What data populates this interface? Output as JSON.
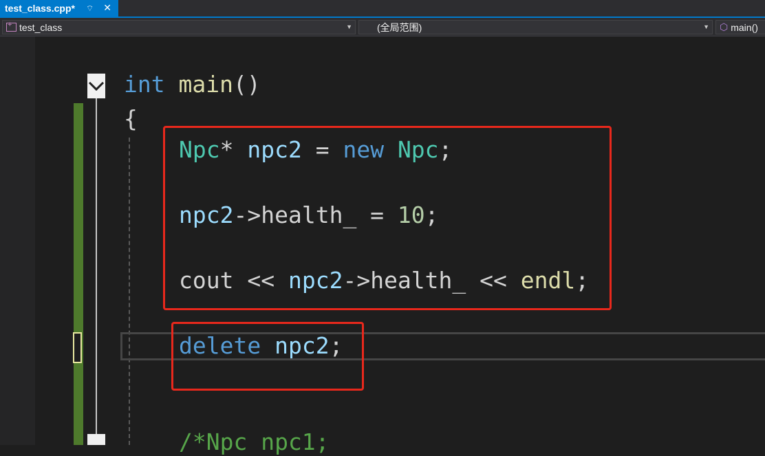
{
  "tab": {
    "title": "test_class.cpp*",
    "pin_glyph": "⌔",
    "close_glyph": "✕"
  },
  "navbar": {
    "project": "test_class",
    "scope": "(全局范围)",
    "member": "main()"
  },
  "code": {
    "l1": {
      "kw": "int",
      "fn": "main",
      "punct": "()"
    },
    "l2": {
      "brace": "{"
    },
    "l3": {
      "type1": "Npc",
      "star": "*",
      "var": "npc2",
      "eq": " = ",
      "kw": "new",
      "type2": "Npc",
      "semi": ";"
    },
    "l4": {
      "var": "npc2",
      "arrow": "->",
      "member": "health_",
      "eq": " = ",
      "num": "10",
      "semi": ";"
    },
    "l5": {
      "cout": "cout",
      "op1": " << ",
      "var": "npc2",
      "arrow": "->",
      "member": "health_",
      "op2": " << ",
      "endl": "endl",
      "semi": ";"
    },
    "l6": {
      "kw": "delete",
      "var": "npc2",
      "semi": ";"
    },
    "l7": {
      "comment": "/*Npc npc1;"
    }
  },
  "colors": {
    "keyword": "#569cd6",
    "type": "#4ec9b0",
    "identifier": "#9cdcfe",
    "function": "#dcdcaa",
    "number": "#b5cea8",
    "comment": "#57a64a",
    "highlight_box": "#e8281c",
    "tab_active": "#007acc"
  },
  "icons": {
    "project": "project-icon",
    "member": "cube-icon",
    "dropdown": "chevron-down-icon",
    "fold": "collapse-chevron-icon"
  }
}
